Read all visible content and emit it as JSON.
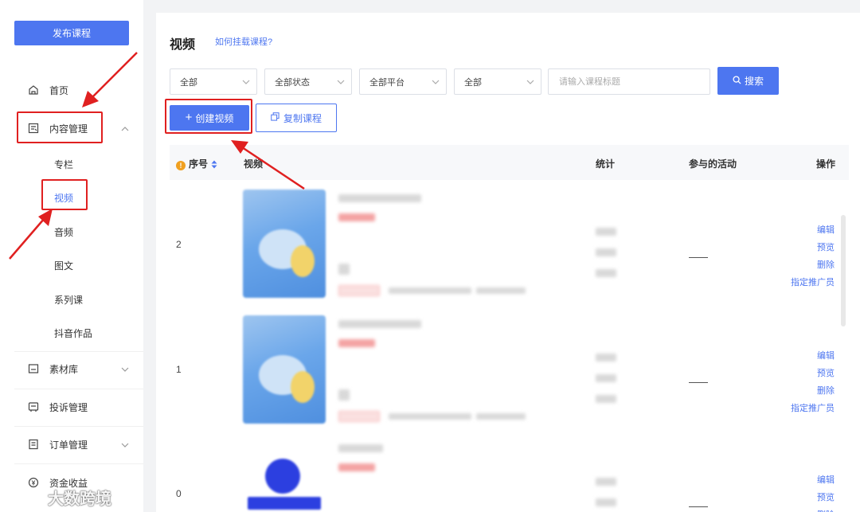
{
  "sidebar": {
    "publish_button": "发布课程",
    "items": [
      {
        "label": "首页",
        "icon": "home-icon"
      },
      {
        "label": "内容管理",
        "icon": "content-icon"
      },
      {
        "label": "素材库",
        "icon": "folder-icon"
      },
      {
        "label": "投诉管理",
        "icon": "complaint-icon"
      },
      {
        "label": "订单管理",
        "icon": "order-icon"
      },
      {
        "label": "资金收益",
        "icon": "money-icon"
      }
    ],
    "sub_items": [
      "专栏",
      "视频",
      "音频",
      "图文",
      "系列课",
      "抖音作品"
    ],
    "active_sub": "视频"
  },
  "header": {
    "title": "视频",
    "help_link": "如何挂载课程?"
  },
  "filters": {
    "select1": "全部",
    "select2": "全部状态",
    "select3": "全部平台",
    "select4": "全部",
    "search_placeholder": "请输入课程标题",
    "search_button": "搜索"
  },
  "actions": {
    "create_button": "创建视频",
    "copy_button": "复制课程"
  },
  "table": {
    "columns": [
      "序号",
      "视频",
      "统计",
      "参与的活动",
      "操作"
    ],
    "rows": [
      {
        "index": "2",
        "activity": "——",
        "ops": [
          "编辑",
          "预览",
          "删除",
          "指定推广员"
        ]
      },
      {
        "index": "1",
        "activity": "——",
        "ops": [
          "编辑",
          "预览",
          "删除",
          "指定推广员"
        ]
      },
      {
        "index": "0",
        "activity": "——",
        "ops": [
          "编辑",
          "预览",
          "删除"
        ]
      }
    ]
  },
  "watermark": "大数跨境",
  "colors": {
    "primary": "#4d76f0",
    "annotation": "#e02020"
  }
}
